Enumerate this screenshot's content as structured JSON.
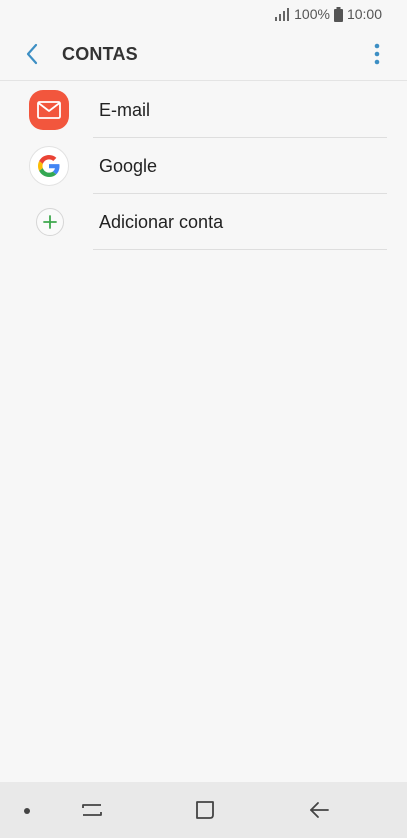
{
  "status_bar": {
    "battery": "100%",
    "time": "10:00",
    "icons": [
      "signal-icon",
      "battery-icon"
    ]
  },
  "header": {
    "title": "CONTAS",
    "back_icon": "chevron-left-icon",
    "more_icon": "more-vertical-icon",
    "accent_color": "#3d8fc4"
  },
  "accounts": {
    "items": [
      {
        "label": "E-mail",
        "icon": "email-app-icon",
        "color": "#f2563d"
      },
      {
        "label": "Google",
        "icon": "google-app-icon"
      },
      {
        "label": "Adicionar conta",
        "icon": "plus-icon",
        "color": "#3ea84d"
      }
    ]
  },
  "nav_bar": {
    "icons": [
      "nav-dot",
      "recent-apps-icon",
      "home-icon",
      "back-arrow-icon"
    ]
  }
}
